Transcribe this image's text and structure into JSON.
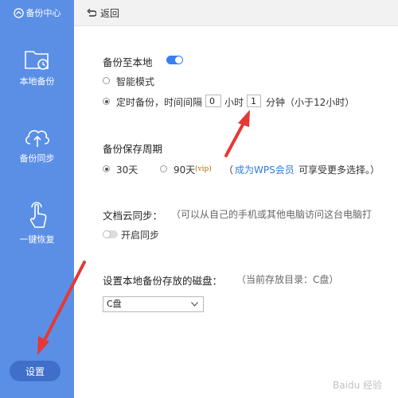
{
  "sidebar": {
    "title": "备份中心",
    "items": [
      {
        "label": "本地备份"
      },
      {
        "label": "备份同步"
      },
      {
        "label": "一键恢复"
      }
    ],
    "settings_label": "设置"
  },
  "topbar": {
    "back_label": "返回"
  },
  "local_backup": {
    "title": "备份至本地",
    "toggle_on": true,
    "smart_mode_label": "智能模式",
    "scheduled_label": "定时备份，时间间隔",
    "hours_value": "0",
    "hours_unit": "小时",
    "minutes_value": "1",
    "minutes_unit": "分钟（小于12小时）"
  },
  "retention": {
    "title": "备份保存周期",
    "option_30": "30天",
    "option_90": "90天",
    "vip_tag": "(vip)",
    "paren_open": "（",
    "member_link": "成为WPS会员",
    "member_suffix": "可享受更多选择。）"
  },
  "cloud_sync": {
    "title": "文档云同步：",
    "hint": "（可以从自己的手机或其他电脑访问这台电脑打",
    "toggle_label": "开启同步",
    "toggle_on": false
  },
  "disk": {
    "title": "设置本地备份存放的磁盘：",
    "hint": "（当前存放目录：C盘）",
    "selected": "C盘"
  },
  "watermark": "Baidu 经验",
  "colors": {
    "sidebar": "#5b8fe6",
    "settings_button": "#3f6fc8",
    "toggle_on": "#3b7ff2",
    "link": "#2d7de0",
    "annotation_arrow": "#e53935"
  }
}
